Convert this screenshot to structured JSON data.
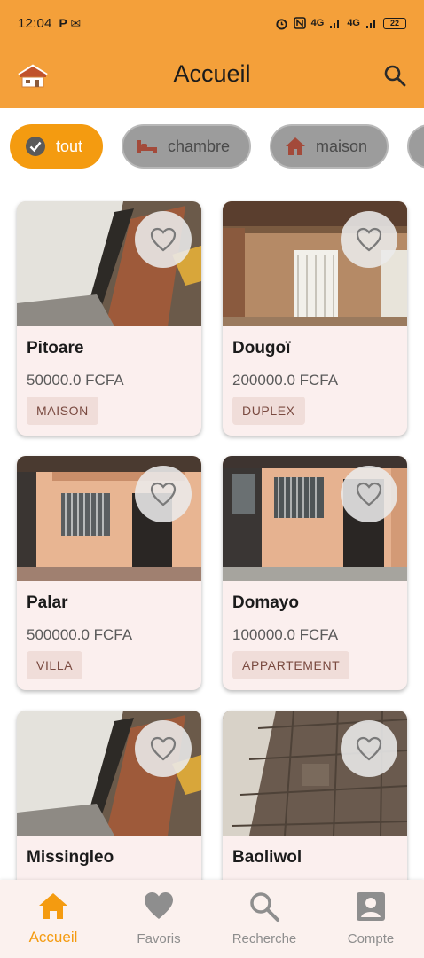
{
  "status_bar": {
    "time": "12:04",
    "left_glyphs": "P ✉",
    "signal_1": "4G",
    "signal_2": "4G",
    "battery": "22"
  },
  "app_bar": {
    "title": "Accueil",
    "logo_icon": "house-logo-icon",
    "search_icon": "search-icon"
  },
  "categories": [
    {
      "label": "tout",
      "icon": "check-circle-icon",
      "active": true
    },
    {
      "label": "chambre",
      "icon": "bed-icon",
      "active": false
    },
    {
      "label": "maison",
      "icon": "house-icon",
      "active": false
    }
  ],
  "listings": [
    {
      "name": "Pitoare",
      "price": "50000.0 FCFA",
      "type": "MAISON",
      "photo": "interior-doorway"
    },
    {
      "name": "Dougoï",
      "price": "200000.0 FCFA",
      "type": "DUPLEX",
      "photo": "interior-window-room"
    },
    {
      "name": "Palar",
      "price": "500000.0 FCFA",
      "type": "VILLA",
      "photo": "exterior-orange-wall"
    },
    {
      "name": "Domayo",
      "price": "100000.0 FCFA",
      "type": "APPARTEMENT",
      "photo": "exterior-window-door"
    },
    {
      "name": "Missingleo",
      "price": "",
      "type": "",
      "photo": "interior-doorway"
    },
    {
      "name": "Baoliwol",
      "price": "",
      "type": "",
      "photo": "tiled-floor"
    }
  ],
  "bottom_nav": [
    {
      "label": "Accueil",
      "icon": "home-icon",
      "active": true
    },
    {
      "label": "Favoris",
      "icon": "heart-icon",
      "active": false
    },
    {
      "label": "Recherche",
      "icon": "search-icon",
      "active": false
    },
    {
      "label": "Compte",
      "icon": "account-icon",
      "active": false
    }
  ],
  "colors": {
    "primary": "#F4A03A",
    "chip_active": "#F49B10",
    "chip_inactive": "#9C9C9C",
    "card_bg": "#FBEFEE",
    "tag_bg": "#F0DDD9",
    "nav_active": "#F49B10",
    "nav_inactive": "#8E8E8E"
  }
}
